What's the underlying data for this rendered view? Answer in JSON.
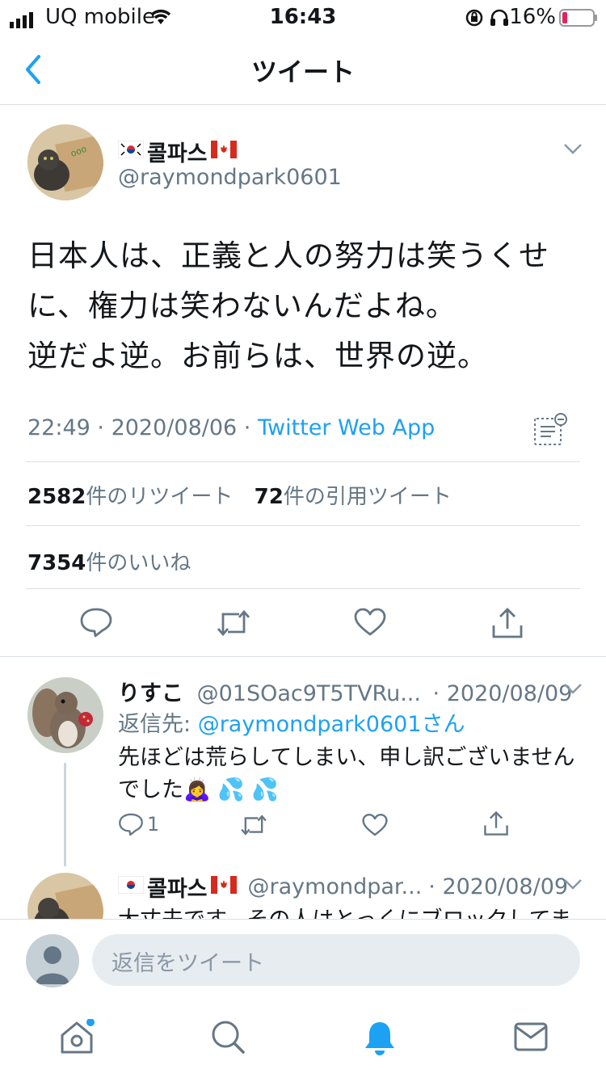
{
  "status_bar": {
    "carrier": "UQ mobile",
    "time": "16:43",
    "battery": "16%"
  },
  "nav": {
    "title": "ツイート"
  },
  "tweet": {
    "name": "콜파스",
    "handle": "@raymondpark0601",
    "text_lines": [
      "日本人は、正義と人の努力は笑うくせ",
      "に、権力は笑わないんだよね。",
      "逆だよ逆。お前らは、世界の逆。"
    ],
    "time": "22:49",
    "date": "2020/08/06",
    "source": "Twitter Web App",
    "retweets_count": "2582",
    "retweets_label": "件のリツイート",
    "quotes_count": "72",
    "quotes_label": "件の引用ツイート",
    "likes_count": "7354",
    "likes_label": "件のいいね"
  },
  "replies": [
    {
      "name": "りすこ",
      "handle": "@01SOac9T5TVRu...",
      "date": "· 2020/08/09",
      "reply_to_prefix": "返信先: ",
      "reply_to_handle": "@raymondpark0601さん",
      "text_lines": [
        "先ほどは荒らしてしまい、申し訳ございません",
        "でした🙇‍♀️ 💦 💦"
      ],
      "reply_count": "1"
    },
    {
      "name": "콜파스",
      "handle": "@raymondpar...",
      "date": "· 2020/08/09",
      "text_lines": [
        "大丈夫です。その人はとっくにブロックしてま"
      ]
    }
  ],
  "compose": {
    "placeholder": "返信をツイート"
  },
  "colors": {
    "accent": "#1da1f2",
    "muted": "#657786",
    "divider": "#d9dfe3",
    "battery_low": "#e0245e"
  },
  "icons": {
    "flags": [
      "south-korea-flag-icon",
      "canada-flag-icon"
    ],
    "tab_bar": [
      "home-icon",
      "search-icon",
      "bell-icon",
      "mail-icon"
    ]
  }
}
